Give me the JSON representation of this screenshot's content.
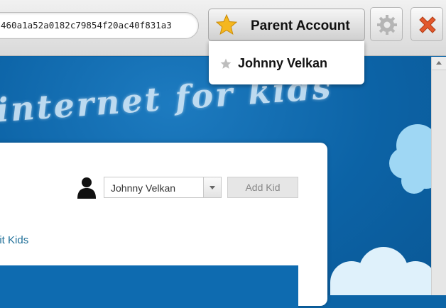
{
  "toolbar": {
    "url_value": "460a1a52a0182c79854f20ac40f831a3",
    "account_button_label": "Parent Account"
  },
  "dropdown": {
    "items": [
      {
        "label": "Johnny Velkan"
      }
    ]
  },
  "banner": {
    "tagline": "internet for kids"
  },
  "panel": {
    "kid_select_value": "Johnny Velkan",
    "add_kid_label": "Add Kid",
    "edit_kids_label": "Edit Kids"
  },
  "icons": {
    "account": "star-icon",
    "settings": "gear-icon",
    "close": "close-icon",
    "profile": "person-silhouette-icon"
  },
  "colors": {
    "star": "#f5b71f",
    "close": "#e2572c",
    "page_blue": "#0c64a6",
    "link": "#1f6f98"
  }
}
